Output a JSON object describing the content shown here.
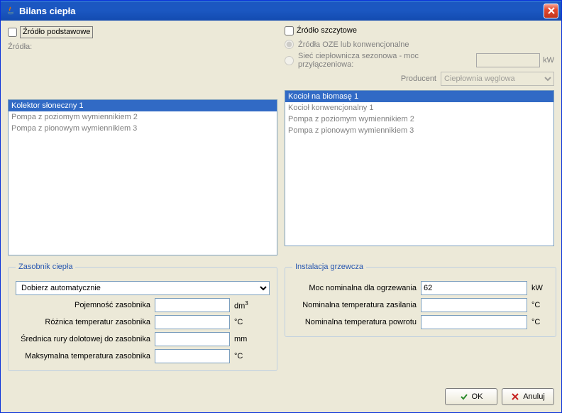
{
  "window": {
    "title": "Bilans ciepła"
  },
  "left": {
    "sourceBasicLabel": "Źródło podstawowe",
    "sourcesLabel": "Źródła:",
    "list": [
      {
        "label": "Kolektor słoneczny 1",
        "selected": true
      },
      {
        "label": "Pompa z poziomym wymiennikiem 2",
        "selected": false
      },
      {
        "label": "Pompa z pionowym wymiennikiem 3",
        "selected": false
      }
    ]
  },
  "right": {
    "sourcePeakLabel": "Źródło szczytowe",
    "radioOzeLabel": "Źródła OZE lub konwencjonalne",
    "radioNetLabel": "Sieć ciepłownicza sezonowa - moc przyłączeniowa:",
    "netUnit": "kW",
    "producerLabel": "Producent",
    "producerValue": "Ciepłownia węglowa",
    "list": [
      {
        "label": "Kocioł na biomasę 1",
        "selected": true
      },
      {
        "label": "Kocioł konwencjonalny 1",
        "selected": false
      },
      {
        "label": "Pompa z poziomym wymiennikiem 2",
        "selected": false
      },
      {
        "label": "Pompa z pionowym wymiennikiem 3",
        "selected": false
      }
    ]
  },
  "tank": {
    "legend": "Zasobnik ciepła",
    "autoSelectLabel": "Dobierz automatycznie",
    "capacityLabel": "Pojemność zasobnika",
    "capacityUnitHtml": "dm³",
    "tempDiffLabel": "Różnica temperatur zasobnika",
    "tempDiffUnit": "°C",
    "pipeDiamLabel": "Średnica rury dolotowej do zasobnika",
    "pipeDiamUnit": "mm",
    "maxTempLabel": "Maksymalna temperatura zasobnika",
    "maxTempUnit": "°C",
    "capacityValue": "",
    "tempDiffValue": "",
    "pipeDiamValue": "",
    "maxTempValue": ""
  },
  "install": {
    "legend": "Instalacja grzewcza",
    "nomPowerLabel": "Moc nominalna dla ogrzewania",
    "nomPowerValue": "62",
    "nomPowerUnit": "kW",
    "supplyTempLabel": "Nominalna temperatura zasilania",
    "supplyTempValue": "",
    "supplyTempUnit": "°C",
    "returnTempLabel": "Nominalna temperatura powrotu",
    "returnTempValue": "",
    "returnTempUnit": "°C"
  },
  "buttons": {
    "ok": "OK",
    "cancel": "Anuluj"
  }
}
